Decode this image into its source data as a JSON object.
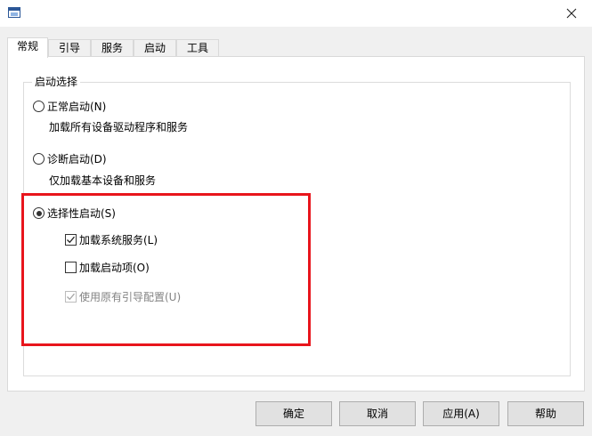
{
  "window": {
    "title": ""
  },
  "tabs": [
    {
      "label": "常规",
      "active": true
    },
    {
      "label": "引导",
      "active": false
    },
    {
      "label": "服务",
      "active": false
    },
    {
      "label": "启动",
      "active": false
    },
    {
      "label": "工具",
      "active": false
    }
  ],
  "startup_group": {
    "title": "启动选择",
    "normal": {
      "label": "正常启动(N)",
      "description": "加载所有设备驱动程序和服务",
      "selected": false
    },
    "diagnostic": {
      "label": "诊断启动(D)",
      "description": "仅加载基本设备和服务",
      "selected": false
    },
    "selective": {
      "label": "选择性启动(S)",
      "selected": true
    },
    "load_services": {
      "label": "加载系统服务(L)",
      "checked": true
    },
    "load_startup": {
      "label": "加载启动项(O)",
      "checked": false
    },
    "use_original_boot": {
      "label": "使用原有引导配置(U)",
      "checked": true,
      "disabled": true
    }
  },
  "buttons": {
    "ok": "确定",
    "cancel": "取消",
    "apply": "应用(A)",
    "help": "帮助"
  },
  "colors": {
    "highlight": "#e8151c",
    "panel_bg": "#ffffff",
    "window_bg": "#f0f0f0"
  }
}
